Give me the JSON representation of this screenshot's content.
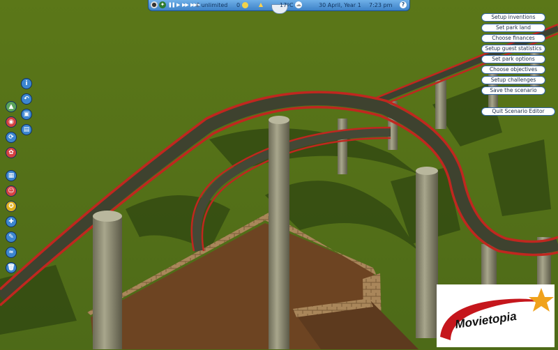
{
  "topbar": {
    "money": "£ unlimited",
    "guests": "0",
    "temperature": "17ºC",
    "date": "30 April, Year 1",
    "time": "7:23 pm",
    "help": "?"
  },
  "editor_menu": {
    "items": [
      "Setup inventions",
      "Set park land",
      "Choose finances",
      "Setup guest statistics",
      "Set park options",
      "Choose objectives",
      "Setup challenges",
      "Save the scenario"
    ],
    "quit": "Quit Scenario Editor"
  },
  "left_toolbar": {
    "icons": [
      "info-icon",
      "terrain-icon",
      "save-icon",
      "camera-icon",
      "rotate-icon",
      "open-icon",
      "scenery-icon",
      "park-icon",
      "guests-icon",
      "rides-icon",
      "paths-icon",
      "scenery-tools-icon",
      "water-icon",
      "trash-icon"
    ]
  },
  "logo": {
    "text": "Movietopia"
  },
  "colors": {
    "grass": "#55721a",
    "track_rail": "#c0271f",
    "support": "#8d8c74",
    "dirt": "#6b4422",
    "ui_blue": "#3d82c8"
  }
}
